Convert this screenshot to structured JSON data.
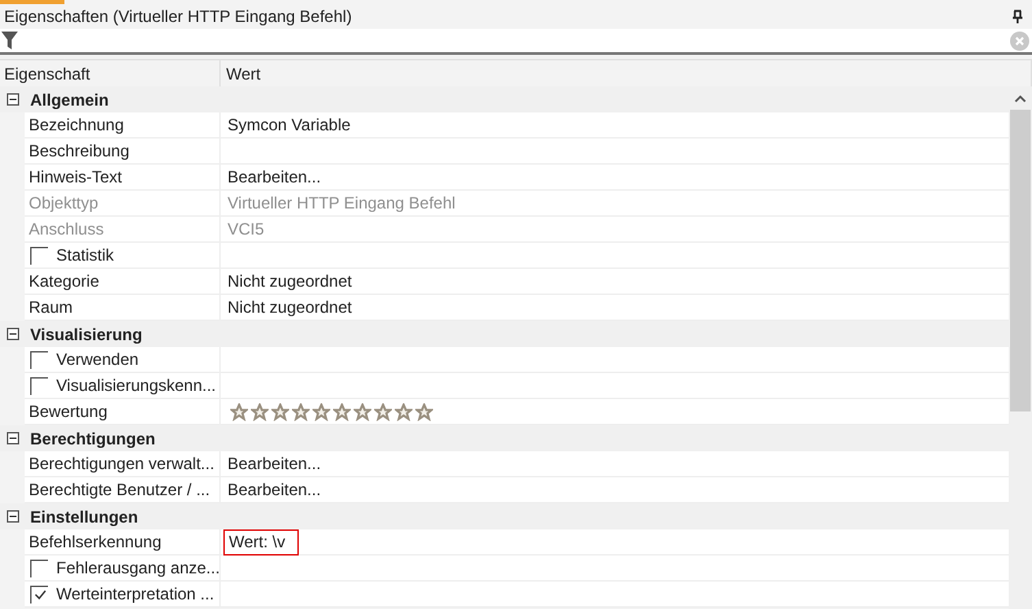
{
  "panel": {
    "title": "Eigenschaften (Virtueller HTTP Eingang Befehl)"
  },
  "columns": [
    "Eigenschaft",
    "Wert"
  ],
  "groups": [
    {
      "name": "Allgemein",
      "expanded": true,
      "rows": [
        {
          "kind": "text",
          "name": "Bezeichnung",
          "value": "Symcon Variable",
          "disabled": false
        },
        {
          "kind": "text",
          "name": "Beschreibung",
          "disabled": false
        },
        {
          "kind": "text",
          "name": "Hinweis-Text",
          "value": "Bearbeiten...",
          "disabled": false
        },
        {
          "kind": "text",
          "name": "Objekttyp",
          "value": "Virtueller HTTP Eingang Befehl",
          "disabled": true
        },
        {
          "kind": "text",
          "name": "Anschluss",
          "value": "VCI5",
          "disabled": true
        },
        {
          "kind": "checkbox",
          "name": "Statistik",
          "checked": false
        },
        {
          "kind": "text",
          "name": "Kategorie",
          "value": "Nicht zugeordnet",
          "disabled": false
        },
        {
          "kind": "text",
          "name": "Raum",
          "value": "Nicht zugeordnet",
          "disabled": false
        }
      ]
    },
    {
      "name": "Visualisierung",
      "expanded": true,
      "rows": [
        {
          "kind": "checkbox",
          "name": "Verwenden",
          "checked": false
        },
        {
          "kind": "checkbox",
          "name": "Visualisierungskenn...",
          "checked": false
        },
        {
          "kind": "stars",
          "name": "Bewertung",
          "stars": 0
        }
      ]
    },
    {
      "name": "Berechtigungen",
      "expanded": true,
      "rows": [
        {
          "kind": "text",
          "name": "Berechtigungen verwalt...",
          "value": "Bearbeiten...",
          "disabled": false
        },
        {
          "kind": "text",
          "name": "Berechtigte Benutzer / ...",
          "value": "Bearbeiten...",
          "disabled": false
        }
      ]
    },
    {
      "name": "Einstellungen",
      "expanded": true,
      "rows": [
        {
          "kind": "text",
          "name": "Befehlserkennung",
          "value": "Wert: \\v",
          "disabled": false,
          "highlighted": true
        },
        {
          "kind": "checkbox",
          "name": "Fehlerausgang anze...",
          "checked": false
        },
        {
          "kind": "checkbox",
          "name": "Werteinterpretation ...",
          "checked": true
        }
      ]
    }
  ]
}
